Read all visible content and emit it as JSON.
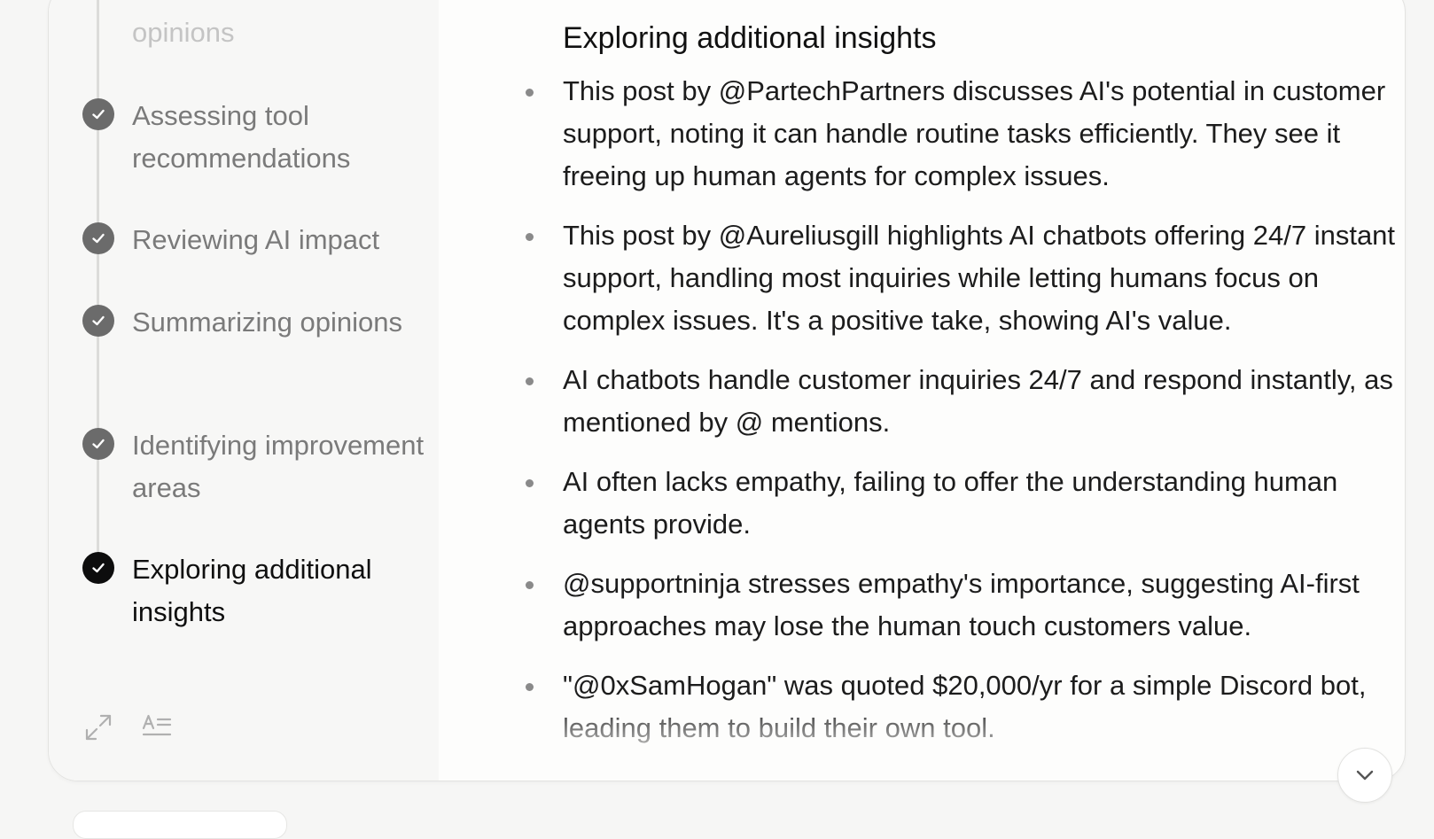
{
  "sidebar": {
    "steps": [
      {
        "label": "opinions",
        "state": "faded"
      },
      {
        "label": "Assessing tool recommendations",
        "state": "done"
      },
      {
        "label": "Reviewing AI impact",
        "state": "done"
      },
      {
        "label": "Summarizing opinions",
        "state": "done"
      },
      {
        "label": "Identifying improvement areas",
        "state": "done"
      },
      {
        "label": "Exploring additional insights",
        "state": "active"
      }
    ],
    "footer_icons": [
      "expand-icon",
      "text-format-icon"
    ]
  },
  "content": {
    "heading": "Exploring additional insights",
    "bullets": [
      "This post by @PartechPartners discusses AI's potential in customer support, noting it can handle routine tasks efficiently. They see it freeing up human agents for complex issues.",
      "This post by @Aureliusgill highlights AI chatbots offering 24/7 instant support, handling most inquiries while letting humans focus on complex issues. It's a positive take, showing AI's value.",
      "AI chatbots handle customer inquiries 24/7 and respond instantly, as mentioned by @ mentions.",
      "AI often lacks empathy, failing to offer the understanding human agents provide.",
      "@supportninja stresses empathy's importance, suggesting AI-first approaches may lose the human touch customers value.",
      "\"@0xSamHogan\" was quoted $20,000/yr for a simple Discord bot, leading them to build their own tool."
    ]
  },
  "controls": {
    "scroll_down_icon": "chevron-down-icon"
  },
  "colors": {
    "active_check": "#0d0d0d",
    "done_check": "#6b6b6b",
    "muted_text": "#7a7a7a",
    "body_text": "#1c1c1c"
  }
}
